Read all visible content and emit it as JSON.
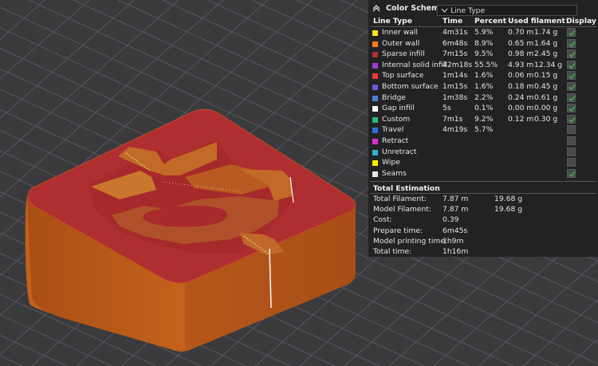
{
  "legend": {
    "title": "Color Scheme",
    "scheme": "Line Type",
    "headers": {
      "line_type": "Line Type",
      "time": "Time",
      "percent": "Percent",
      "used": "Used filament",
      "display": "Display"
    },
    "rows": [
      {
        "name": "Inner wall",
        "color": "#ffe616",
        "time": "4m31s",
        "percent": "5.9%",
        "len": "0.70 m",
        "weight": "1.74 g",
        "display": true
      },
      {
        "name": "Outer wall",
        "color": "#ff7c16",
        "time": "6m48s",
        "percent": "8.9%",
        "len": "0.65 m",
        "weight": "1.64 g",
        "display": true
      },
      {
        "name": "Sparse infill",
        "color": "#b23030",
        "time": "7m15s",
        "percent": "9.5%",
        "len": "0.98 m",
        "weight": "2.45 g",
        "display": true
      },
      {
        "name": "Internal solid infill",
        "color": "#9b3fd1",
        "time": "42m18s",
        "percent": "55.5%",
        "len": "4.93 m",
        "weight": "12.34 g",
        "display": true
      },
      {
        "name": "Top surface",
        "color": "#ef3b3b",
        "time": "1m14s",
        "percent": "1.6%",
        "len": "0.06 m",
        "weight": "0.15 g",
        "display": true
      },
      {
        "name": "Bottom surface",
        "color": "#6a5ccf",
        "time": "1m15s",
        "percent": "1.6%",
        "len": "0.18 m",
        "weight": "0.45 g",
        "display": true
      },
      {
        "name": "Bridge",
        "color": "#4b7fd6",
        "time": "1m38s",
        "percent": "2.2%",
        "len": "0.24 m",
        "weight": "0.61 g",
        "display": true
      },
      {
        "name": "Gap infill",
        "color": "#ffffff",
        "time": "5s",
        "percent": "0.1%",
        "len": "0.00 m",
        "weight": "0.00 g",
        "display": true
      },
      {
        "name": "Custom",
        "color": "#2fb87a",
        "time": "7m1s",
        "percent": "9.2%",
        "len": "0.12 m",
        "weight": "0.30 g",
        "display": true
      },
      {
        "name": "Travel",
        "color": "#2f6fd6",
        "time": "4m19s",
        "percent": "5.7%",
        "len": "",
        "weight": "",
        "display": false
      },
      {
        "name": "Retract",
        "color": "#d631d6",
        "time": "",
        "percent": "",
        "len": "",
        "weight": "",
        "display": false
      },
      {
        "name": "Unretract",
        "color": "#2fb3d6",
        "time": "",
        "percent": "",
        "len": "",
        "weight": "",
        "display": false
      },
      {
        "name": "Wipe",
        "color": "#ffee00",
        "time": "",
        "percent": "",
        "len": "",
        "weight": "",
        "display": false
      },
      {
        "name": "Seams",
        "color": "#e8e8e8",
        "time": "",
        "percent": "",
        "len": "",
        "weight": "",
        "display": true
      }
    ]
  },
  "estimation": {
    "title": "Total Estimation",
    "rows": [
      {
        "label": "Total Filament:",
        "value": "7.87 m",
        "extra": "19.68 g"
      },
      {
        "label": "Model Filament:",
        "value": "7.87 m",
        "extra": "19.68 g"
      },
      {
        "label": "Cost:",
        "value": "0.39",
        "extra": ""
      },
      {
        "label": "Prepare time:",
        "value": "6m45s",
        "extra": ""
      },
      {
        "label": "Model printing time:",
        "value": "1h9m",
        "extra": ""
      },
      {
        "label": "Total time:",
        "value": "1h16m",
        "extra": ""
      }
    ]
  },
  "colors": {
    "background": "#3a3a3d",
    "grid": "#5a5a5e",
    "model_side": "#b85a1a",
    "model_top": "#b03030",
    "check": "#3fae4a"
  },
  "icons": {
    "collapse": "chevron-up-icon",
    "dropdown": "chevron-down-icon",
    "check": "checkmark-icon"
  }
}
